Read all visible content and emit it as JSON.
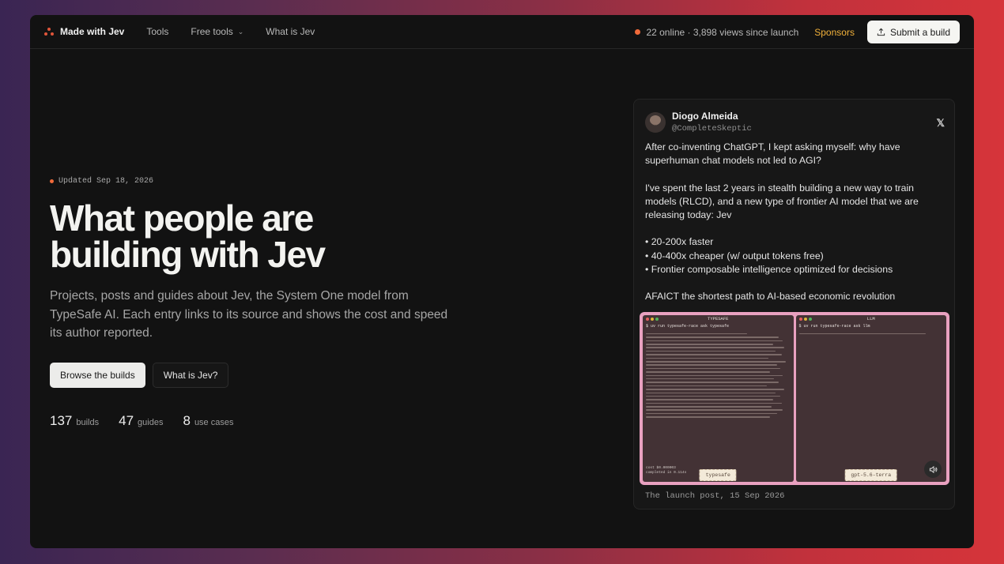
{
  "nav": {
    "brand": "Made with Jev",
    "links": [
      "Tools",
      "Free tools",
      "What is Jev"
    ],
    "status": "22 online · 3,898 views since launch",
    "sponsors": "Sponsors",
    "submit": "Submit a build"
  },
  "hero": {
    "updated": "Updated Sep 18, 2026",
    "title_line1": "What people are",
    "title_line2": "building with Jev",
    "subtitle": "Projects, posts and guides about Jev, the System One model from TypeSafe AI. Each entry links to its source and shows the cost and speed its author reported.",
    "primary_button": "Browse the builds",
    "secondary_button": "What is Jev?",
    "stats": [
      {
        "num": "137",
        "label": "builds"
      },
      {
        "num": "47",
        "label": "guides"
      },
      {
        "num": "8",
        "label": "use cases"
      }
    ]
  },
  "post": {
    "author": "Diogo Almeida",
    "handle": "@CompleteSkeptic",
    "paragraphs": [
      "After co-inventing ChatGPT, I kept asking myself: why have superhuman chat models not led to AGI?",
      "I've spent the last 2 years in stealth building a new way to train models (RLCD), and a new type of frontier AI model that we are releasing today: Jev",
      "• 20-200x faster\n• 40-400x cheaper (w/ output tokens free)\n• Frontier composable intelligence optimized for decisions",
      "AFAICT the shortest path to AI-based economic revolution"
    ],
    "media": {
      "left_title": "TYPESAFE",
      "left_cmd": "$ uv run typesafe-race ask typesafe",
      "left_foot": "cost $0.000003\ncompleted in 0.114s",
      "left_tag": "typesafe",
      "right_title": "LLM",
      "right_cmd": "$ uv run typesafe-race ask llm",
      "right_tag": "gpt-5.6-terra"
    },
    "caption": "The launch post, 15 Sep 2026"
  },
  "colors": {
    "accent": "#f06a3a",
    "sponsor": "#f0b03a",
    "media_border": "#e9a1c0"
  }
}
